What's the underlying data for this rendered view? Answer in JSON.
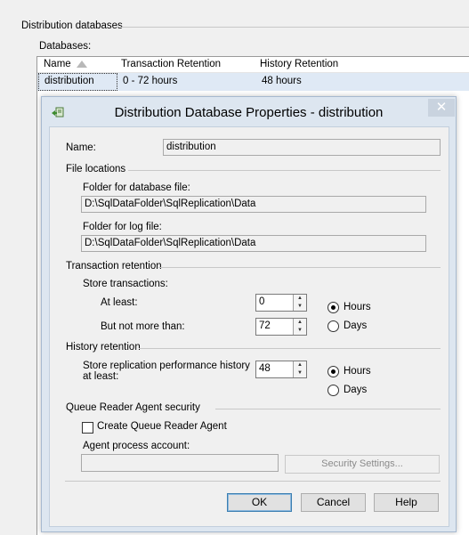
{
  "section_title": "Distribution databases",
  "databases_label": "Databases:",
  "grid": {
    "columns": [
      "Name",
      "Transaction Retention",
      "History Retention"
    ],
    "rows": [
      {
        "name": "distribution",
        "transaction_retention": "0 - 72 hours",
        "history_retention": "48 hours"
      }
    ]
  },
  "dialog": {
    "title": "Distribution Database Properties - distribution",
    "close_glyph": "✕",
    "name_label": "Name:",
    "name_value": "distribution",
    "file_locations": {
      "heading": "File locations",
      "db_folder_label": "Folder for database file:",
      "db_folder_value": "D:\\SqlDataFolder\\SqlReplication\\Data",
      "log_folder_label": "Folder for log file:",
      "log_folder_value": "D:\\SqlDataFolder\\SqlReplication\\Data"
    },
    "transaction_retention": {
      "heading": "Transaction retention",
      "store_label": "Store transactions:",
      "at_least_label": "At least:",
      "at_least_value": "0",
      "max_label": "But not more than:",
      "max_value": "72",
      "unit_hours": "Hours",
      "unit_days": "Days",
      "selected_unit": "Hours"
    },
    "history_retention": {
      "heading": "History retention",
      "store_label": "Store replication performance history at least:",
      "value": "48",
      "unit_hours": "Hours",
      "unit_days": "Days",
      "selected_unit": "Hours"
    },
    "queue_reader": {
      "heading": "Queue Reader Agent security",
      "create_label": "Create Queue Reader Agent",
      "create_checked": false,
      "account_label": "Agent process account:",
      "account_value": "",
      "security_settings_label": "Security Settings..."
    },
    "buttons": {
      "ok": "OK",
      "cancel": "Cancel",
      "help": "Help"
    }
  },
  "colors": {
    "selection_row": "#dfe9f5",
    "dialog_frame": "#dde6f0",
    "default_button_border": "#3c7fb1"
  }
}
